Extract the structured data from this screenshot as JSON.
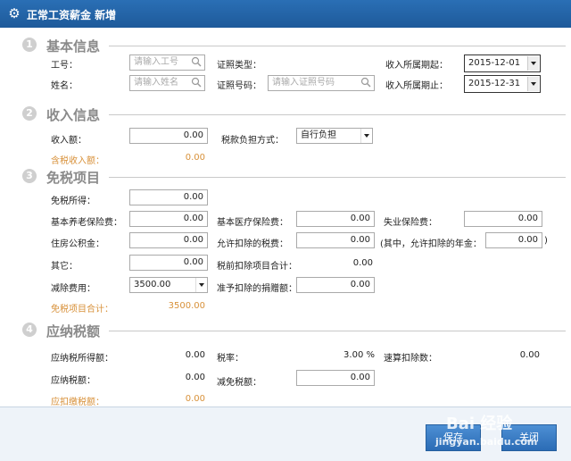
{
  "window": {
    "title": "正常工资薪金 新增",
    "icon": "gear-icon"
  },
  "sections": {
    "basic": {
      "num": "1",
      "title": "基本信息"
    },
    "income": {
      "num": "2",
      "title": "收入信息"
    },
    "exempt": {
      "num": "3",
      "title": "免税项目"
    },
    "tax": {
      "num": "4",
      "title": "应纳税额"
    }
  },
  "basic": {
    "emp_no_label": "工号：",
    "emp_no_placeholder": "请输入工号",
    "id_type_label": "证照类型：",
    "period_start_label": "收入所属期起：",
    "period_start": "2015-12-01",
    "name_label": "姓名：",
    "name_placeholder": "请输入姓名",
    "id_no_label": "证照号码：",
    "id_no_placeholder": "请输入证照号码",
    "period_end_label": "收入所属期止：",
    "period_end": "2015-12-31"
  },
  "income": {
    "amount_label": "收入额：",
    "amount": "0.00",
    "tax_bearing_label": "税款负担方式：",
    "tax_bearing": "自行负担",
    "tax_incl_label": "含税收入额：",
    "tax_incl": "0.00"
  },
  "exempt": {
    "exempt_income_label": "免税所得：",
    "exempt_income": "0.00",
    "pension_label": "基本养老保险费：",
    "pension": "0.00",
    "medical_label": "基本医疗保险费：",
    "medical": "0.00",
    "unemployment_label": "失业保险费：",
    "unemployment": "0.00",
    "housing_label": "住房公积金：",
    "housing": "0.00",
    "allowed_tax_label": "允许扣除的税费：",
    "allowed_tax": "0.00",
    "annuity_label": "(其中，允许扣除的年金：",
    "annuity": "0.00",
    "annuity_close": ")",
    "other_label": "其它：",
    "other": "0.00",
    "pretax_total_label": "税前扣除项目合计：",
    "pretax_total": "0.00",
    "deduction_label": "减除费用：",
    "deduction": "3500.00",
    "donation_label": "准予扣除的捐赠额：",
    "donation": "0.00",
    "exempt_total_label": "免税项目合计：",
    "exempt_total": "3500.00"
  },
  "tax": {
    "taxable_label": "应纳税所得额：",
    "taxable": "0.00",
    "rate_label": "税率：",
    "rate": "3.00 %",
    "quick_deduct_label": "速算扣除数：",
    "quick_deduct": "0.00",
    "payable_label": "应纳税额：",
    "payable": "0.00",
    "relief_label": "减免税额：",
    "relief": "0.00",
    "withhold_label": "应扣缴税额：",
    "withhold": "0.00"
  },
  "footer": {
    "save_label": "保存",
    "close_label": "关闭",
    "watermark_brand": "Bai 经验",
    "watermark_url": "jingyan.baidu.com"
  }
}
